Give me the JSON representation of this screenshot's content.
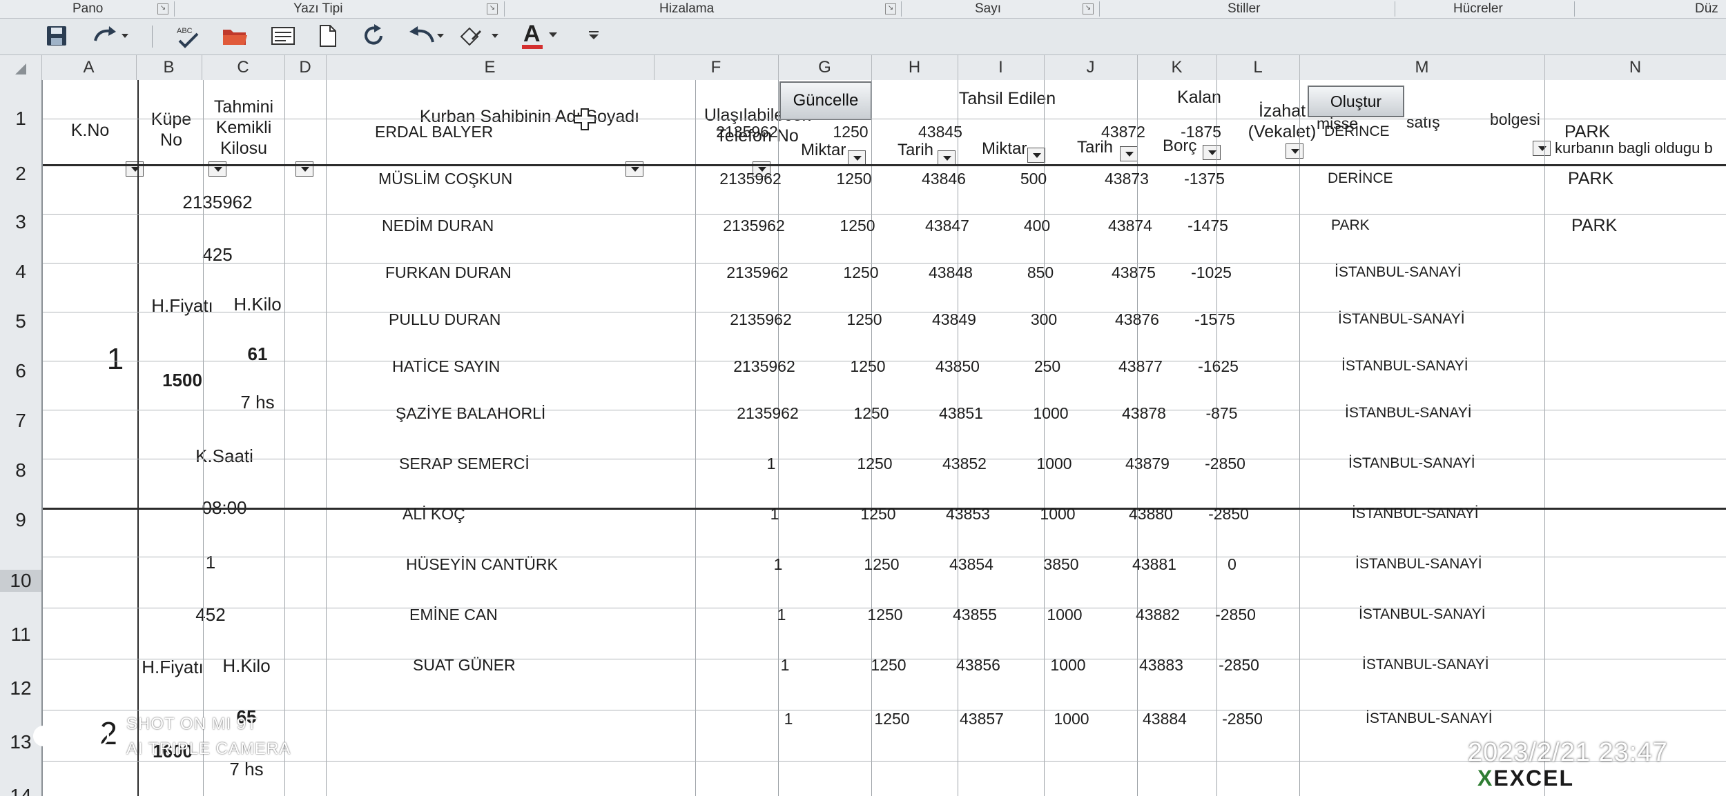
{
  "ribbon": {
    "groups": [
      "Pano",
      "Yazı Tipi",
      "Hizalama",
      "Sayı",
      "Stiller",
      "Hücreler",
      "Düz"
    ]
  },
  "quick_access": {
    "icons": [
      "save-icon",
      "redo-icon",
      "spellcheck-icon",
      "open-folder-icon",
      "form-icon",
      "new-file-icon",
      "refresh-icon",
      "undo-icon",
      "clear-format-icon",
      "font-color-icon",
      "customize-icon"
    ],
    "font_color_glyph": "A",
    "font_color_accent": "#d32f2f"
  },
  "columns": [
    "A",
    "B",
    "C",
    "D",
    "E",
    "F",
    "G",
    "H",
    "I",
    "J",
    "K",
    "L",
    "M",
    "N"
  ],
  "rows": [
    "1",
    "2",
    "3",
    "4",
    "5",
    "6",
    "7",
    "8",
    "9",
    "10",
    "11",
    "12",
    "13",
    "14"
  ],
  "headers": {
    "kno": "K.No",
    "kupe": "Küpe No",
    "kilo": "Tahmini Kemikli Kilosu",
    "owner": "Kurban Sahibinin Adı Soyadı",
    "phone": "Ulaşılabilecek Telefon No",
    "guncelle": "Güncelle",
    "tahsil": "Tahsil Edilen",
    "kalan": "Kalan",
    "izahat": "İzahat (Vekalet)",
    "olustur": "Oluştur",
    "misse": "misse",
    "satis": "satış",
    "bolgesi": "bolgesi",
    "miktar": "Miktar",
    "tarih": "Tarih",
    "borc": "Borç",
    "kurban_bagli": "kurbanın bagli oldugu b"
  },
  "group1": {
    "kno": "1",
    "kupe": "2135962",
    "kilo_total": "425",
    "hfiyat_label": "H.Fiyatı",
    "hkilo_label": "H.Kilo",
    "hfiyat": "1500",
    "hkilo": "61",
    "hs": "7 hs",
    "ksaati_label": "K.Saati",
    "ksaati": "08:00"
  },
  "group2": {
    "kno": "2",
    "kupe": "1",
    "kilo_total": "452",
    "hfiyat_label": "H.Fiyatı",
    "hkilo_label": "H.Kilo",
    "hfiyat": "1600",
    "hkilo": "65",
    "hs": "7 hs"
  },
  "records": [
    {
      "name": "ERDAL BALYER",
      "phone": "2135962",
      "amount": "1250",
      "date": "43845",
      "paid": "",
      "paid_date": "43872",
      "debt": "-1875",
      "region": "DERİNCE",
      "n": "PARK"
    },
    {
      "name": "MÜSLİM COŞKUN",
      "phone": "2135962",
      "amount": "1250",
      "date": "43846",
      "paid": "500",
      "paid_date": "43873",
      "debt": "-1375",
      "region": "DERİNCE",
      "n": "PARK"
    },
    {
      "name": "NEDİM DURAN",
      "phone": "2135962",
      "amount": "1250",
      "date": "43847",
      "paid": "400",
      "paid_date": "43874",
      "debt": "-1475",
      "region": "PARK",
      "n": "PARK"
    },
    {
      "name": "FURKAN DURAN",
      "phone": "2135962",
      "amount": "1250",
      "date": "43848",
      "paid": "850",
      "paid_date": "43875",
      "debt": "-1025",
      "region": "İSTANBUL-SANAYİ",
      "n": ""
    },
    {
      "name": "PULLU DURAN",
      "phone": "2135962",
      "amount": "1250",
      "date": "43849",
      "paid": "300",
      "paid_date": "43876",
      "debt": "-1575",
      "region": "İSTANBUL-SANAYİ",
      "n": ""
    },
    {
      "name": "HATİCE SAYIN",
      "phone": "2135962",
      "amount": "1250",
      "date": "43850",
      "paid": "250",
      "paid_date": "43877",
      "debt": "-1625",
      "region": "İSTANBUL-SANAYİ",
      "n": ""
    },
    {
      "name": "ŞAZİYE BALAHORLİ",
      "phone": "2135962",
      "amount": "1250",
      "date": "43851",
      "paid": "1000",
      "paid_date": "43878",
      "debt": "-875",
      "region": "İSTANBUL-SANAYİ",
      "n": ""
    },
    {
      "name": "SERAP SEMERCİ",
      "phone": "1",
      "amount": "1250",
      "date": "43852",
      "paid": "1000",
      "paid_date": "43879",
      "debt": "-2850",
      "region": "İSTANBUL-SANAYİ",
      "n": ""
    },
    {
      "name": "ALİ KOÇ",
      "phone": "1",
      "amount": "1250",
      "date": "43853",
      "paid": "1000",
      "paid_date": "43880",
      "debt": "-2850",
      "region": "İSTANBUL-SANAYİ",
      "n": ""
    },
    {
      "name": "HÜSEYİN CANTÜRK",
      "phone": "1",
      "amount": "1250",
      "date": "43854",
      "paid": "3850",
      "paid_date": "43881",
      "debt": "0",
      "region": "İSTANBUL-SANAYİ",
      "n": ""
    },
    {
      "name": "EMİNE CAN",
      "phone": "1",
      "amount": "1250",
      "date": "43855",
      "paid": "1000",
      "paid_date": "43882",
      "debt": "-2850",
      "region": "İSTANBUL-SANAYİ",
      "n": ""
    },
    {
      "name": "SUAT GÜNER",
      "phone": "1",
      "amount": "1250",
      "date": "43856",
      "paid": "1000",
      "paid_date": "43883",
      "debt": "-2850",
      "region": "İSTANBUL-SANAYİ",
      "n": ""
    },
    {
      "name": "",
      "phone": "1",
      "amount": "1250",
      "date": "43857",
      "paid": "1000",
      "paid_date": "43884",
      "debt": "-2850",
      "region": "İSTANBUL-SANAYİ",
      "n": ""
    }
  ],
  "overlay": {
    "shot_line1": "SHOT ON MI 9T",
    "shot_line2": "AI TRIPLE CAMERA",
    "timestamp": "2023/2/21  23:47",
    "logo": "EXCEL"
  }
}
